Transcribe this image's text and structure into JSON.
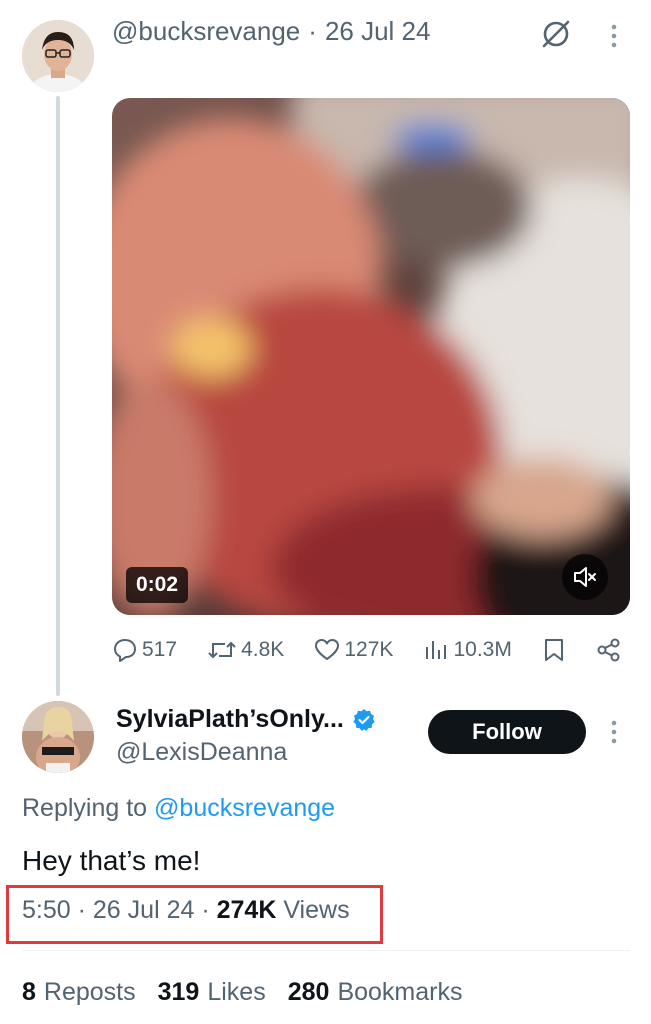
{
  "parent_tweet": {
    "handle": "@bucksrevange",
    "separator": "·",
    "date": "26 Jul 24",
    "video": {
      "duration": "0:02"
    },
    "actions": {
      "replies": "517",
      "reposts": "4.8K",
      "likes": "127K",
      "views": "10.3M"
    }
  },
  "reply_tweet": {
    "display_name": "SylviaPlath’sOnly...",
    "handle": "@LexisDeanna",
    "follow_label": "Follow",
    "replying_prefix": "Replying to",
    "replying_handle": "@bucksrevange",
    "text": "Hey that’s me!",
    "time": "5:50",
    "date": "26 Jul 24",
    "views_count": "274K",
    "views_label": "Views",
    "separator": "·"
  },
  "stats": {
    "reposts_count": "8",
    "reposts_label": "Reposts",
    "likes_count": "319",
    "likes_label": "Likes",
    "bookmarks_count": "280",
    "bookmarks_label": "Bookmarks"
  },
  "colors": {
    "text_primary": "#0f1419",
    "text_secondary": "#536471",
    "link": "#1d9bf0",
    "highlight": "#e0393e"
  },
  "icons": [
    "grok-icon",
    "more-options-icon",
    "mute-icon",
    "reply-icon",
    "repost-icon",
    "like-icon",
    "views-icon",
    "bookmark-icon",
    "share-icon",
    "verified-badge-icon"
  ]
}
